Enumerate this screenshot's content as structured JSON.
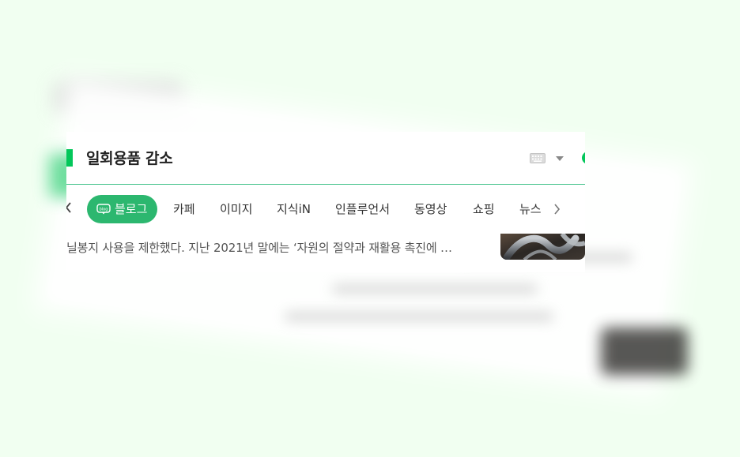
{
  "search": {
    "query": "일회용품 감소"
  },
  "tabs": [
    {
      "label": "블로그",
      "active": true,
      "icon": "blog-icon"
    },
    {
      "label": "카페"
    },
    {
      "label": "이미지"
    },
    {
      "label": "지식iN"
    },
    {
      "label": "인플루언서"
    },
    {
      "label": "동영상"
    },
    {
      "label": "쇼핑"
    },
    {
      "label": "뉴스"
    }
  ],
  "result": {
    "snippet": "닐봉지 사용을 제한했다. 지난 2021년 말에는 ‘자원의 절약과 재활용 촉진에 …"
  },
  "icons": {
    "keyboard": "keyboard-icon",
    "dropdown": "chevron-down-icon",
    "prev": "chevron-left-icon",
    "next": "chevron-right-icon"
  },
  "colors": {
    "background": "#f1fff1",
    "accent_green": "#03c75a",
    "active_tab": "#2cb76f",
    "divider": "#41c289",
    "text_primary": "#222222",
    "text_snippet": "#555555"
  }
}
